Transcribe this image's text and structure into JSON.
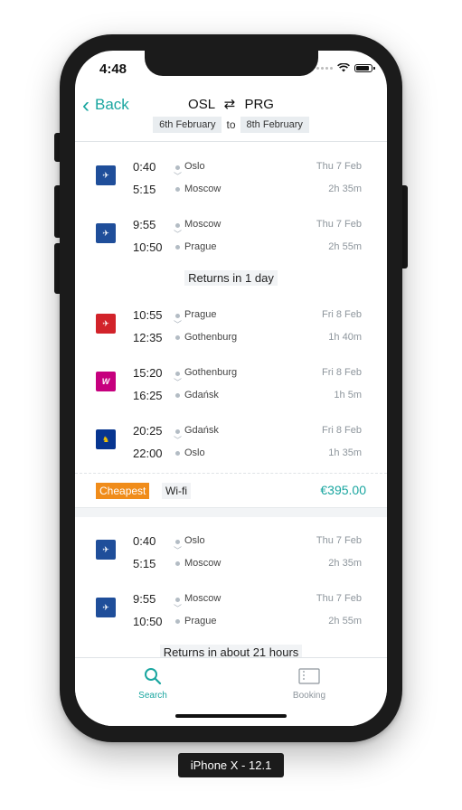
{
  "status": {
    "time": "4:48"
  },
  "nav": {
    "back_label": "Back",
    "origin": "OSL",
    "destination": "PRG",
    "swap_icon": "⇄",
    "date_from": "6th February",
    "date_to_word": "to",
    "date_to": "8th February"
  },
  "trip1": {
    "flights": [
      {
        "logo": "aeroflot",
        "logo_color": "#1f4e9a",
        "dep_time": "0:40",
        "arr_time": "5:15",
        "from": "Oslo",
        "to": "Moscow",
        "date": "Thu 7 Feb",
        "duration": "2h 35m"
      },
      {
        "logo": "aeroflot",
        "logo_color": "#1f4e9a",
        "dep_time": "9:55",
        "arr_time": "10:50",
        "from": "Moscow",
        "to": "Prague",
        "date": "Thu 7 Feb",
        "duration": "2h 55m"
      },
      {
        "logo": "norwegian",
        "logo_color": "#d2232a",
        "dep_time": "10:55",
        "arr_time": "12:35",
        "from": "Prague",
        "to": "Gothenburg",
        "date": "Fri 8 Feb",
        "duration": "1h 40m"
      },
      {
        "logo": "wizz",
        "logo_color": "#c6007e",
        "dep_time": "15:20",
        "arr_time": "16:25",
        "from": "Gothenburg",
        "to": "Gdańsk",
        "date": "Fri 8 Feb",
        "duration": "1h 5m"
      },
      {
        "logo": "ryanair",
        "logo_color": "#073590",
        "dep_time": "20:25",
        "arr_time": "22:00",
        "from": "Gdańsk",
        "to": "Oslo",
        "date": "Fri 8 Feb",
        "duration": "1h 35m"
      }
    ],
    "returns_label": "Returns in 1 day",
    "tag_cheapest": "Cheapest",
    "tag_wifi": "Wi-fi",
    "price": "€395.00"
  },
  "trip2": {
    "flights": [
      {
        "logo": "aeroflot",
        "logo_color": "#1f4e9a",
        "dep_time": "0:40",
        "arr_time": "5:15",
        "from": "Oslo",
        "to": "Moscow",
        "date": "Thu 7 Feb",
        "duration": "2h 35m"
      },
      {
        "logo": "aeroflot",
        "logo_color": "#1f4e9a",
        "dep_time": "9:55",
        "arr_time": "10:50",
        "from": "Moscow",
        "to": "Prague",
        "date": "Thu 7 Feb",
        "duration": "2h 55m"
      }
    ],
    "returns_label": "Returns in about 21 hours"
  },
  "tabs": {
    "search": "Search",
    "booking": "Booking"
  },
  "device_label": "iPhone X - 12.1",
  "colors": {
    "accent": "#1aa6a0",
    "cheapest": "#f08c1a"
  }
}
